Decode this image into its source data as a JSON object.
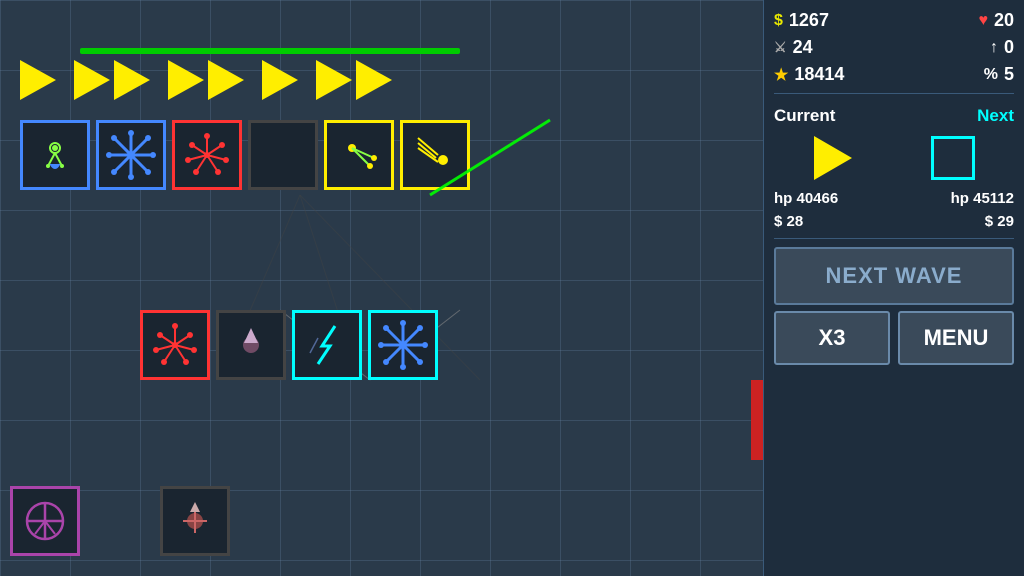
{
  "stats": {
    "money": "1267",
    "hearts": "20",
    "sword": "24",
    "arrow_up": "0",
    "stars": "18414",
    "percent": "5"
  },
  "labels": {
    "current": "Current",
    "next": "Next",
    "hp_current": "hp 40466",
    "hp_next": "hp 45112",
    "cost_current": "$ 28",
    "cost_next": "$ 29",
    "next_wave": "NEXT WAVE",
    "x3": "X3",
    "menu": "MENU"
  },
  "icons": {
    "dollar": "$",
    "heart": "♥",
    "sword": "⚔",
    "arrow": "↑",
    "star": "★",
    "percent": "%"
  }
}
